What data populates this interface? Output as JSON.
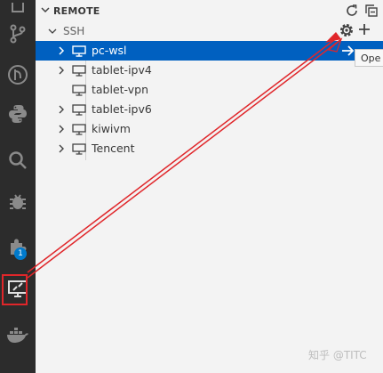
{
  "activity_bar": {
    "items": [
      {
        "name": "explorer-icon"
      },
      {
        "name": "source-control-icon"
      },
      {
        "name": "git-graph-icon"
      },
      {
        "name": "python-icon"
      },
      {
        "name": "search-icon"
      },
      {
        "name": "debug-icon"
      },
      {
        "name": "extensions-icon"
      },
      {
        "name": "remote-explorer-icon"
      },
      {
        "name": "docker-icon"
      }
    ],
    "extensions_badge": "1"
  },
  "sidebar": {
    "section_title": "REMOTE",
    "group_label": "SSH",
    "hosts": [
      {
        "label": "pc-wsl",
        "selected": true,
        "expandable": true
      },
      {
        "label": "tablet-ipv4",
        "selected": false,
        "expandable": true
      },
      {
        "label": "tablet-vpn",
        "selected": false,
        "expandable": false
      },
      {
        "label": "tablet-ipv6",
        "selected": false,
        "expandable": true
      },
      {
        "label": "kiwivm",
        "selected": false,
        "expandable": true
      },
      {
        "label": "Tencent",
        "selected": false,
        "expandable": true
      }
    ],
    "tooltip": "Ope"
  },
  "watermark": "知乎 @TITC",
  "colors": {
    "selection": "#0060c0",
    "annotation": "#e0262a",
    "activity_bg": "#2c2c2c"
  }
}
